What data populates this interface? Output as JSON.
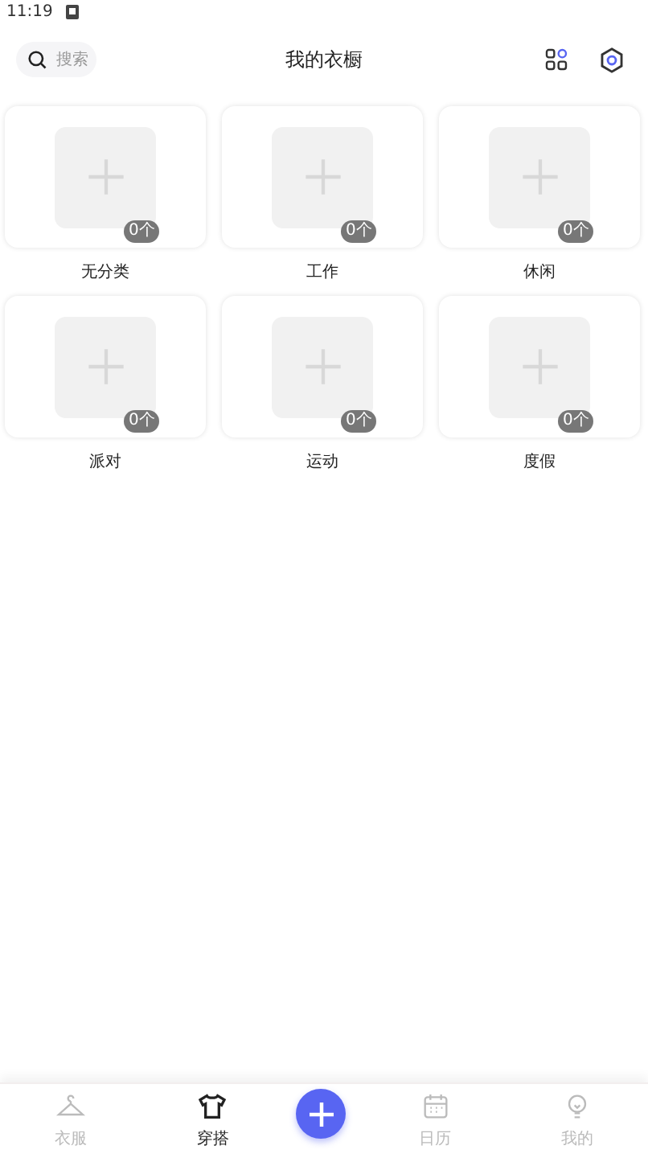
{
  "status_bar": {
    "time": "11:19"
  },
  "header": {
    "search": {
      "placeholder": "搜索"
    },
    "title": "我的衣橱"
  },
  "categories": [
    {
      "name": "无分类",
      "count": "0个"
    },
    {
      "name": "工作",
      "count": "0个"
    },
    {
      "name": "休闲",
      "count": "0个"
    },
    {
      "name": "派对",
      "count": "0个"
    },
    {
      "name": "运动",
      "count": "0个"
    },
    {
      "name": "度假",
      "count": "0个"
    }
  ],
  "tabs": [
    {
      "label": "衣服",
      "selected": false
    },
    {
      "label": "穿搭",
      "selected": true
    },
    {
      "label": "日历",
      "selected": false
    },
    {
      "label": "我的",
      "selected": false
    }
  ]
}
